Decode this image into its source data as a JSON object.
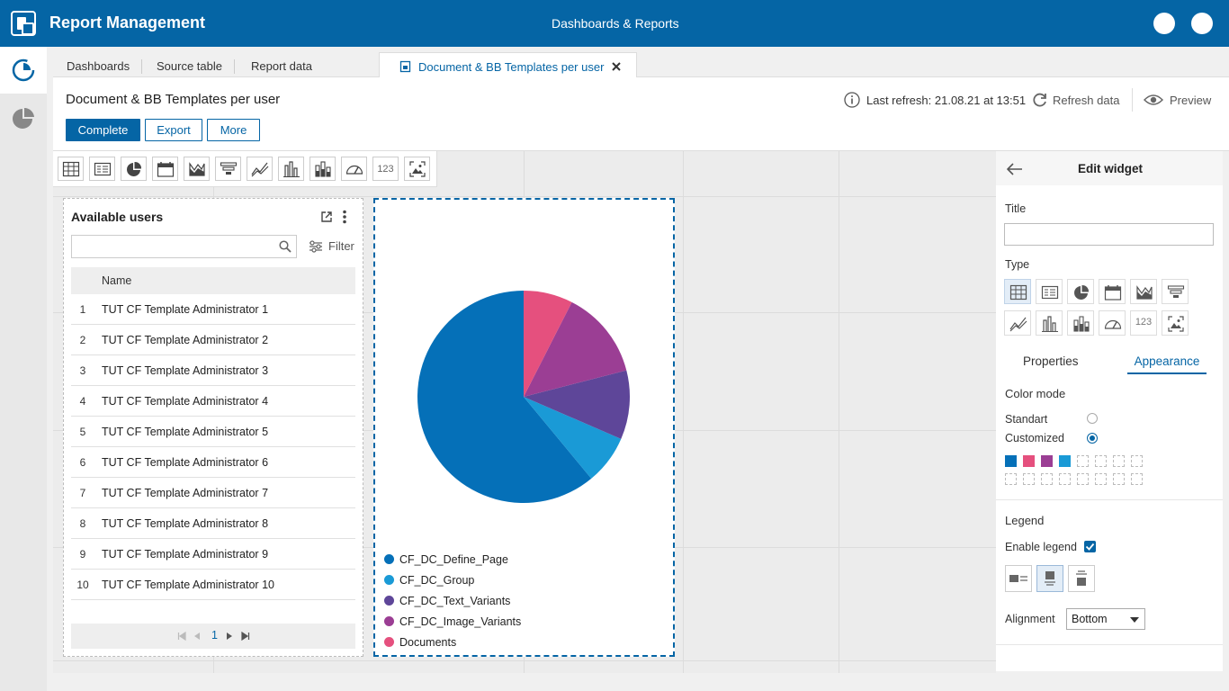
{
  "app": {
    "title": "Report Management",
    "center_title": "Dashboards & Reports"
  },
  "tabs": [
    {
      "label": "Dashboards"
    },
    {
      "label": "Source table"
    },
    {
      "label": "Report data"
    },
    {
      "label": "Document & BB Templates per user",
      "active": true
    }
  ],
  "header": {
    "title": "Document & BB Templates per user",
    "buttons": {
      "complete": "Complete",
      "export": "Export",
      "more": "More"
    },
    "last_refresh": "Last refresh: 21.08.21 at 13:51",
    "refresh": "Refresh data",
    "preview": "Preview"
  },
  "users_widget": {
    "title": "Available users",
    "search_placeholder": "",
    "filter": "Filter",
    "column_name": "Name",
    "rows": [
      {
        "num": "1",
        "name": "TUT CF Template Administrator 1"
      },
      {
        "num": "2",
        "name": "TUT CF Template Administrator 2"
      },
      {
        "num": "3",
        "name": "TUT CF Template Administrator 3"
      },
      {
        "num": "4",
        "name": "TUT CF Template Administrator 4"
      },
      {
        "num": "5",
        "name": "TUT CF Template Administrator 5"
      },
      {
        "num": "6",
        "name": "TUT CF Template Administrator 6"
      },
      {
        "num": "7",
        "name": "TUT CF Template Administrator 7"
      },
      {
        "num": "8",
        "name": "TUT CF Template Administrator 8"
      },
      {
        "num": "9",
        "name": "TUT CF Template Administrator 9"
      },
      {
        "num": "10",
        "name": "TUT CF Template Administrator 10"
      }
    ],
    "page": "1"
  },
  "chart_data": {
    "type": "pie",
    "categories": [
      "CF_DC_Define_Page",
      "CF_DC_Group",
      "CF_DC_Text_Variants",
      "CF_DC_Image_Variants",
      "Documents"
    ],
    "values": [
      61,
      7.5,
      10.5,
      13.5,
      7.5
    ],
    "colors": [
      "#0570b8",
      "#1a9ad6",
      "#5e4699",
      "#9b3e94",
      "#e5507e"
    ],
    "legend": "bottom"
  },
  "edit_panel": {
    "title": "Edit widget",
    "title_label": "Title",
    "title_value": "",
    "type_label": "Type",
    "tab_properties": "Properties",
    "tab_appearance": "Appearance",
    "color_mode_label": "Color mode",
    "standart": "Standart",
    "customized": "Customized",
    "swatches": [
      "#0570b8",
      "#e5507e",
      "#9b3e94",
      "#1a9ad6"
    ],
    "legend_label": "Legend",
    "enable_legend": "Enable legend",
    "alignment_label": "Alignment",
    "alignment_value": "Bottom"
  },
  "toolbox_text_tool": "123"
}
